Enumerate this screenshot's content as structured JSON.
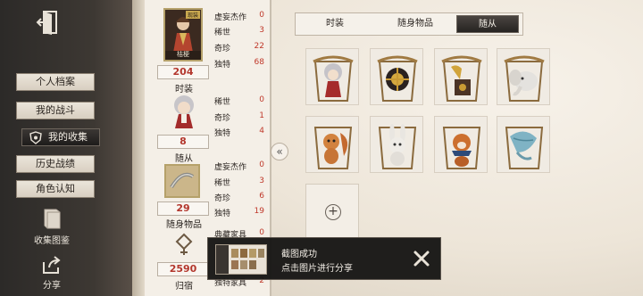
{
  "sidebar": {
    "nav": [
      {
        "label": "个人档案",
        "active": false
      },
      {
        "label": "我的战斗",
        "active": false
      },
      {
        "label": "我的收集",
        "active": true
      },
      {
        "label": "历史战绩",
        "active": false
      },
      {
        "label": "角色认知",
        "active": false
      }
    ],
    "tools": {
      "album_label": "收集图鉴",
      "share_label": "分享"
    }
  },
  "stats": {
    "costume": {
      "portrait_caption": "桔梗",
      "badge": "现装",
      "count": "204",
      "label": "时装",
      "rows": [
        {
          "label": "虚妄杰作",
          "value": "0"
        },
        {
          "label": "稀世",
          "value": "3"
        },
        {
          "label": "奇珍",
          "value": "22"
        },
        {
          "label": "独特",
          "value": "68"
        }
      ]
    },
    "follower": {
      "count": "8",
      "label": "随从",
      "rows": [
        {
          "label": "稀世",
          "value": "0"
        },
        {
          "label": "奇珍",
          "value": "1"
        },
        {
          "label": "独特",
          "value": "4"
        }
      ]
    },
    "accessory": {
      "count": "29",
      "label": "随身物品",
      "rows": [
        {
          "label": "虚妄杰作",
          "value": "0"
        },
        {
          "label": "稀世",
          "value": "3"
        },
        {
          "label": "奇珍",
          "value": "6"
        },
        {
          "label": "独特",
          "value": "19"
        }
      ]
    },
    "home": {
      "count": "2590",
      "label": "归宿",
      "rows": [
        {
          "label": "典藏家具",
          "value": "0"
        },
        {
          "label": "独特家具",
          "value": "2"
        }
      ]
    }
  },
  "tabs": [
    {
      "label": "时装",
      "active": false
    },
    {
      "label": "随身物品",
      "active": false
    },
    {
      "label": "随从",
      "active": true
    }
  ],
  "grid_items": [
    {
      "name": "grey-haired-doll-in-red-dress"
    },
    {
      "name": "black-gold-orb-pet"
    },
    {
      "name": "gramophone-creature"
    },
    {
      "name": "white-elephant"
    },
    {
      "name": "squirrel"
    },
    {
      "name": "white-rabbit"
    },
    {
      "name": "red-panda-with-scarf"
    },
    {
      "name": "blue-leaf-creature"
    }
  ],
  "toast": {
    "title": "截图成功",
    "subtitle": "点击图片进行分享"
  },
  "colors": {
    "accent_red": "#c0392b",
    "frame_gold": "#b5a16a",
    "dark_panel": "#262321"
  }
}
